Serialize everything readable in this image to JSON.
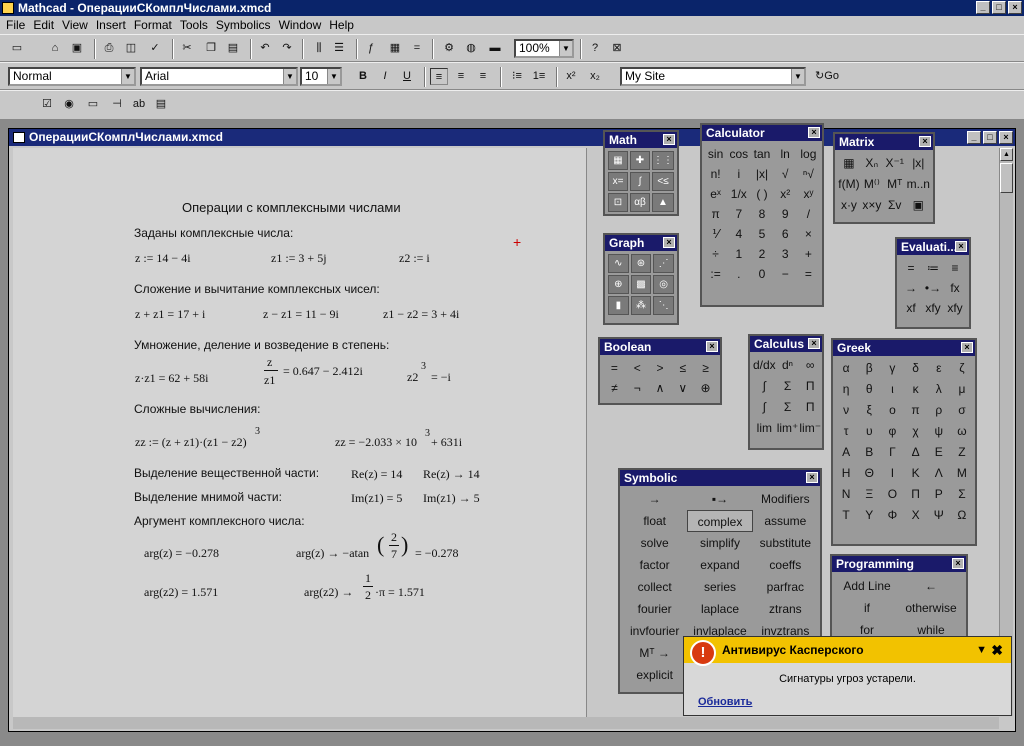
{
  "app": {
    "title": "Mathcad - ОперацииСКомплЧислами.xmcd"
  },
  "menu": [
    "File",
    "Edit",
    "View",
    "Insert",
    "Format",
    "Tools",
    "Symbolics",
    "Window",
    "Help"
  ],
  "toolbar": {
    "zoom": "100%",
    "style": "Normal",
    "font": "Arial",
    "size": "10",
    "site": "My Site",
    "go": "Go"
  },
  "doc": {
    "title": "ОперацииСКомплЧислами.xmcd",
    "heading": "Операции с комплексными числами",
    "lines": {
      "given": "Заданы  комплексные числа:",
      "z": "z := 14 − 4i",
      "z1": "z1 := 3 + 5j",
      "z2": "z2 := i",
      "addsub": "Сложение и вычитание  комплексных чисел:",
      "a1": "z + z1 = 17 + i",
      "a2": "z − z1 = 11 − 9i",
      "a3": "z1 − z2 = 3 + 4i",
      "mul": "Умножение, деление и возведение в степень:",
      "m1": "z·z1 = 62 + 58i",
      "m2n": "z",
      "m2d": "z1",
      "m2r": "= 0.647 − 2.412i",
      "m3": "z2",
      "m3e": "3",
      "m3r": "= −i",
      "complex": "Сложные вычисления:",
      "c1": "zz := (z + z1)·(z1 − z2)",
      "c1e": "3",
      "c2": "zz = −2.033 × 10",
      "c2e": "3",
      "c2r": " + 631i",
      "real": "Выделение вещественной части:",
      "r1": "Re(z) = 14",
      "r2": "Re(z) → 14",
      "imag": "Выделение мнимой части:",
      "i1": "Im(z1) = 5",
      "i2": "Im(z1) → 5",
      "arg": "Аргумент комплексного числа:",
      "g1": "arg(z) = −0.278",
      "g2": "arg(z) → −atan",
      "g2n": "2",
      "g2d": "7",
      "g2r": "= −0.278",
      "g3": "arg(z2) = 1.571",
      "g4": "arg(z2) →",
      "g4n": "1",
      "g4d": "2",
      "g4r": "·π = 1.571"
    }
  },
  "palettes": {
    "math": "Math",
    "graph": "Graph",
    "boolean": "Boolean",
    "calculator": "Calculator",
    "calculus": "Calculus",
    "matrix": "Matrix",
    "evaluation": "Evaluati...",
    "greek": "Greek",
    "symbolic": "Symbolic",
    "programming": "Programming",
    "calc_keys": [
      "sin",
      "cos",
      "tan",
      "ln",
      "log",
      "n!",
      "i",
      "|x|",
      "√",
      "ⁿ√",
      "eˣ",
      "1/x",
      "( )",
      "x²",
      "xʸ",
      "π",
      "7",
      "8",
      "9",
      "/",
      "⅟",
      "4",
      "5",
      "6",
      "×",
      "÷",
      "1",
      "2",
      "3",
      "+",
      ":=",
      ".",
      "0",
      "−",
      "="
    ],
    "bool_keys": [
      "=",
      "<",
      ">",
      "≤",
      "≥",
      "≠",
      "¬",
      "∧",
      "∨",
      "⊕"
    ],
    "greek_keys": [
      "α",
      "β",
      "γ",
      "δ",
      "ε",
      "ζ",
      "η",
      "θ",
      "ι",
      "κ",
      "λ",
      "μ",
      "ν",
      "ξ",
      "ο",
      "π",
      "ρ",
      "σ",
      "τ",
      "υ",
      "φ",
      "χ",
      "ψ",
      "ω",
      "Α",
      "Β",
      "Γ",
      "Δ",
      "Ε",
      "Ζ",
      "Η",
      "Θ",
      "Ι",
      "Κ",
      "Λ",
      "Μ",
      "Ν",
      "Ξ",
      "Ο",
      "Π",
      "Ρ",
      "Σ",
      "Τ",
      "Υ",
      "Φ",
      "Χ",
      "Ψ",
      "Ω"
    ],
    "eval_keys": [
      "=",
      "≔",
      "≡",
      "→",
      "•→",
      "fx",
      "xf",
      "xfy",
      "xfy"
    ],
    "sym_keys": [
      "→",
      "▪→",
      "Modifiers",
      "float",
      "complex",
      "assume",
      "solve",
      "simplify",
      "substitute",
      "factor",
      "expand",
      "coeffs",
      "collect",
      "series",
      "parfrac",
      "fourier",
      "laplace",
      "ztrans",
      "invfourier",
      "invlaplace",
      "invztrans",
      "Mᵀ →",
      "",
      "",
      "explicit",
      "",
      ""
    ],
    "prog_keys": [
      "Add Line",
      "←",
      "if",
      "otherwise",
      "for",
      "while"
    ]
  },
  "kaspersky": {
    "title": "Антивирус Касперского",
    "message": "Сигнатуры угроз устарели.",
    "link": "Обновить"
  }
}
